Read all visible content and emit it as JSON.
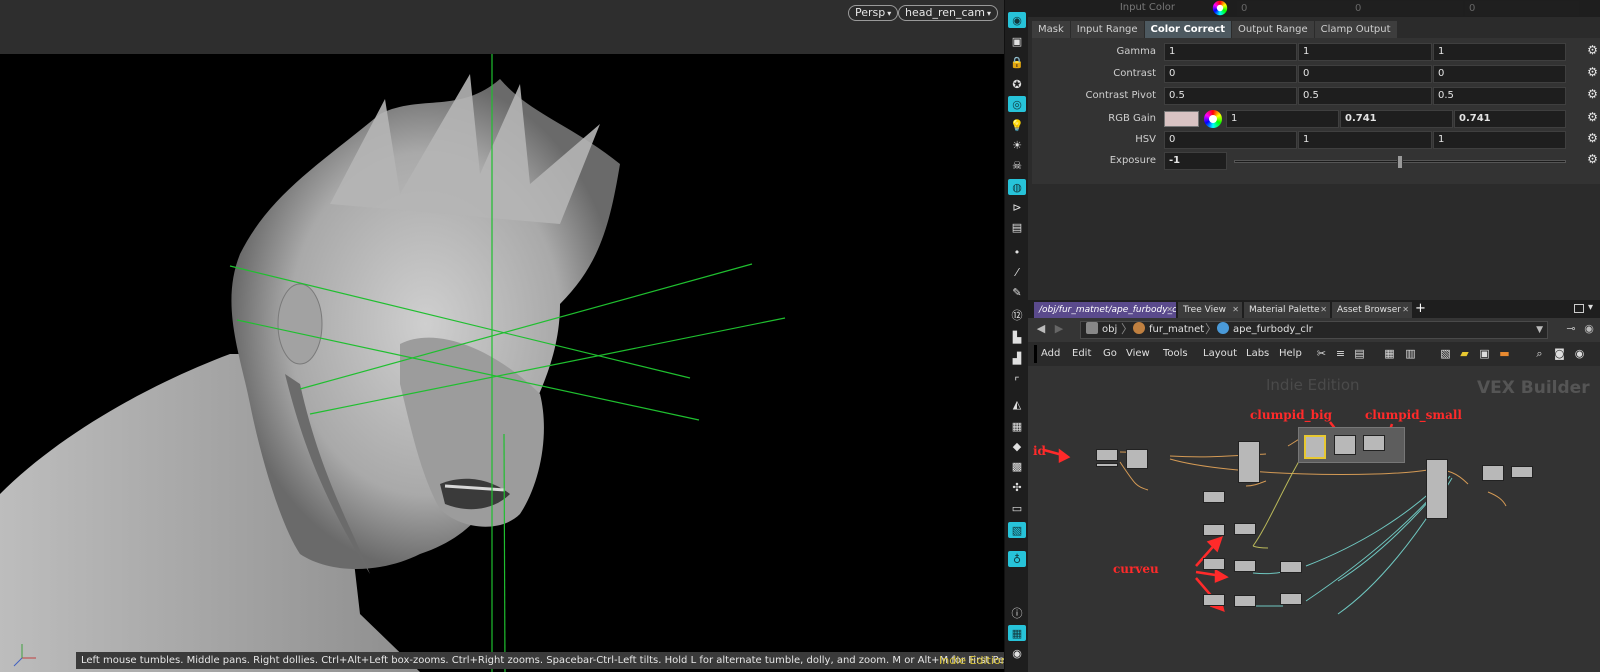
{
  "viewport": {
    "camera_menu": "Persp",
    "render_cam_menu": "head_ren_cam",
    "status_text": "Left mouse tumbles. Middle pans. Right dollies. Ctrl+Alt+Left box-zooms. Ctrl+Right zooms. Spacebar-Ctrl-Left tilts. Hold L for alternate tumble, dolly, and zoom.     M or Alt+M for First Person Navigation.",
    "edition_label": "Indie Edition"
  },
  "shelf": {
    "tools": [
      {
        "name": "view-icon",
        "glyph": "◉",
        "on": true
      },
      {
        "name": "snapshot-icon",
        "glyph": "▣",
        "on": false
      },
      {
        "name": "lock-icon",
        "glyph": "🔒",
        "on": false
      },
      {
        "name": "ghost-icon",
        "glyph": "✪",
        "on": false
      },
      {
        "name": "display-icon",
        "glyph": "◎",
        "on": true
      },
      {
        "name": "light-icon",
        "glyph": "💡",
        "on": false
      },
      {
        "name": "headlight-icon",
        "glyph": "☀",
        "on": false
      },
      {
        "name": "skull-icon",
        "glyph": "☠",
        "on": false
      },
      {
        "name": "shaded-icon",
        "glyph": "◍",
        "on": true
      },
      {
        "name": "wire-icon",
        "glyph": "⊳",
        "on": false
      },
      {
        "name": "camera-icon",
        "glyph": "▤",
        "on": false
      },
      {
        "name": "point-icon",
        "glyph": "•",
        "on": false
      },
      {
        "name": "brush-icon",
        "glyph": "⁄",
        "on": false
      },
      {
        "name": "pen-icon",
        "glyph": "✎",
        "on": false
      },
      {
        "name": "number-icon",
        "glyph": "⑫",
        "on": false
      },
      {
        "name": "paint-icon",
        "glyph": "▙",
        "on": false
      },
      {
        "name": "stamp-icon",
        "glyph": "▟",
        "on": false
      },
      {
        "name": "corner-icon",
        "glyph": "⌜",
        "on": false
      },
      {
        "name": "ramp-icon",
        "glyph": "◭",
        "on": false
      },
      {
        "name": "grid-icon",
        "glyph": "▦",
        "on": false
      },
      {
        "name": "gem-icon",
        "glyph": "◆",
        "on": false
      },
      {
        "name": "film-icon",
        "glyph": "▩",
        "on": false
      },
      {
        "name": "fan-icon",
        "glyph": "✣",
        "on": false
      },
      {
        "name": "frame-icon",
        "glyph": "▭",
        "on": false
      },
      {
        "name": "render-icon",
        "glyph": "▧",
        "on": true
      },
      {
        "name": "bulb-icon",
        "glyph": "♁",
        "on": true
      },
      {
        "name": "info-icon",
        "glyph": "ⓘ",
        "on": false
      },
      {
        "name": "layout-icon",
        "glyph": "▦",
        "on": true
      },
      {
        "name": "eye-icon",
        "glyph": "◉",
        "on": false
      }
    ]
  },
  "params": {
    "top_label": "Input Color",
    "top_values": [
      "0",
      "0",
      "0"
    ],
    "tabs": [
      "Mask",
      "Input Range",
      "Color Correct",
      "Output Range",
      "Clamp Output"
    ],
    "active_tab": "Color Correct",
    "rows": {
      "gamma": {
        "label": "Gamma",
        "values": [
          "1",
          "1",
          "1"
        ]
      },
      "contrast": {
        "label": "Contrast",
        "values": [
          "0",
          "0",
          "0"
        ]
      },
      "contrast_pivot": {
        "label": "Contrast Pivot",
        "values": [
          "0.5",
          "0.5",
          "0.5"
        ]
      },
      "rgb_gain": {
        "label": "RGB Gain",
        "values": [
          "1",
          "0.741",
          "0.741"
        ],
        "swatch_color": "#d9c3c3"
      },
      "hsv": {
        "label": "HSV",
        "values": [
          "0",
          "1",
          "1"
        ]
      },
      "exposure": {
        "label": "Exposure",
        "value": "-1",
        "slider_fraction": 0.5
      }
    }
  },
  "network": {
    "tabs": [
      "/obj/fur_matnet/ape_furbody_clr",
      "Tree View",
      "Material Palette",
      "Asset Browser"
    ],
    "path": [
      "obj",
      "fur_matnet",
      "ape_furbody_clr"
    ],
    "menu": [
      "Add",
      "Edit",
      "Go",
      "View",
      "Tools",
      "Layout",
      "Labs",
      "Help"
    ],
    "watermark_context": "VEX Builder",
    "watermark_edition": "Indie Edition",
    "annotations": {
      "id": "id",
      "clumpid_big": "clumpid_big",
      "clumpid_small": "clumpid_small",
      "curveu": "curveu"
    }
  },
  "colors": {
    "accent": "#27c3d9",
    "selected_node": "#e8c830",
    "annotation": "#ff2a2a",
    "wire_teal": "#6fc7c0",
    "wire_orange": "#d49a55",
    "guide_green": "#1fbf2f"
  }
}
